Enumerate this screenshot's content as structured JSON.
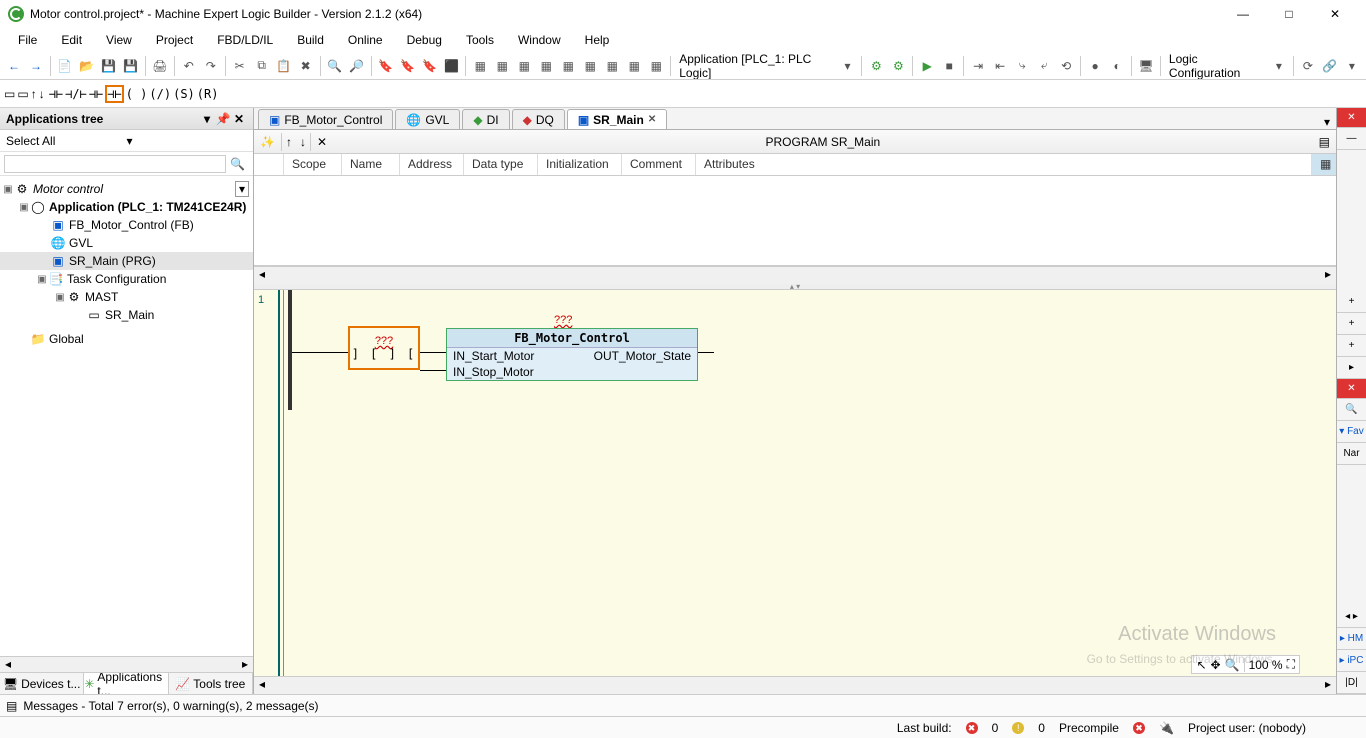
{
  "window": {
    "title": "Motor control.project* - Machine Expert Logic Builder - Version 2.1.2 (x64)"
  },
  "menu": [
    "File",
    "Edit",
    "View",
    "Project",
    "FBD/LD/IL",
    "Build",
    "Online",
    "Debug",
    "Tools",
    "Window",
    "Help"
  ],
  "toolbar": {
    "app_context": "Application [PLC_1: PLC Logic]",
    "logic_config": "Logic Configuration"
  },
  "sidebar": {
    "title": "Applications tree",
    "select_all": "Select All",
    "root": "Motor control",
    "app": "Application (PLC_1: TM241CE24R)",
    "items": {
      "fb": "FB_Motor_Control (FB)",
      "gvl": "GVL",
      "srmain": "SR_Main (PRG)",
      "taskcfg": "Task Configuration",
      "mast": "MAST",
      "srmain2": "SR_Main",
      "global": "Global"
    }
  },
  "bottom_tabs": {
    "devices": "Devices t...",
    "apps": "Applications t...",
    "tools": "Tools tree"
  },
  "file_tabs": {
    "fb": "FB_Motor_Control",
    "gvl": "GVL",
    "di": "DI",
    "dq": "DQ",
    "sr": "SR_Main"
  },
  "declaration": {
    "crumb": "PROGRAM SR_Main",
    "cols": [
      "Scope",
      "Name",
      "Address",
      "Data type",
      "Initialization",
      "Comment",
      "Attributes"
    ]
  },
  "ladder": {
    "rung": "1",
    "contact_placeholder": "???",
    "instance_placeholder": "???",
    "fb_name": "FB_Motor_Control",
    "in1": "IN_Start_Motor",
    "in2": "IN_Stop_Motor",
    "out1": "OUT_Motor_State"
  },
  "right_panel": {
    "fav": "▾ Fav",
    "nar": "Nar",
    "hm": "▸ HM",
    "ipc": "▸ iPC",
    "d": "|D|"
  },
  "zoom": {
    "value": "100 %"
  },
  "messages": "Messages - Total 7 error(s), 0 warning(s), 2 message(s)",
  "status": {
    "lastbuild": "Last build:",
    "err": "0",
    "warn": "0",
    "precompile": "Precompile",
    "user": "Project user: (nobody)"
  },
  "watermark": {
    "l1": "Activate Windows",
    "l2": "Go to Settings to activate Windows."
  }
}
